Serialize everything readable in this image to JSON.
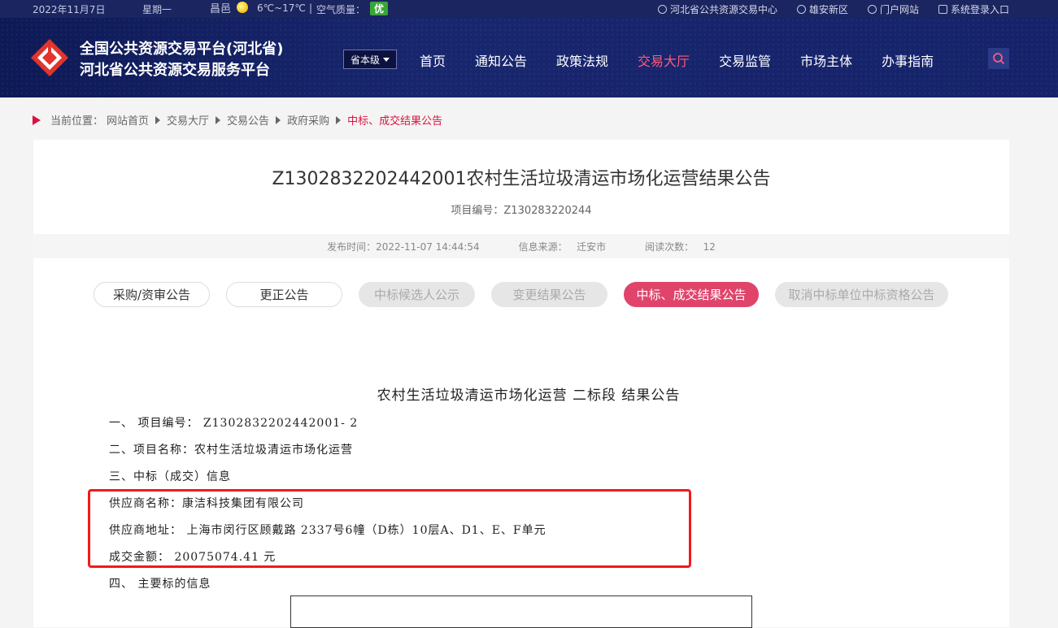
{
  "topbar": {
    "date": "2022年11月7日",
    "weekday": "星期一",
    "city": "昌邑",
    "temp": "6℃~17℃",
    "divider": "|",
    "aq_label": "空气质量：",
    "aq_value": "优",
    "links": [
      {
        "label": "河北省公共资源交易中心",
        "icon": "globe-icon"
      },
      {
        "label": "雄安新区",
        "icon": "globe-icon"
      },
      {
        "label": "门户网站",
        "icon": "globe-icon"
      },
      {
        "label": "系统登录入口",
        "icon": "chart-icon"
      }
    ]
  },
  "header": {
    "line1": "全国公共资源交易平台(河北省)",
    "line2": "河北省公共资源交易服务平台",
    "level": "省本级",
    "nav": [
      "首页",
      "通知公告",
      "政策法规",
      "交易大厅",
      "交易监管",
      "市场主体",
      "办事指南"
    ],
    "active_nav": "交易大厅"
  },
  "breadcrumb": {
    "prefix": "当前位置：",
    "items": [
      "网站首页",
      "交易大厅",
      "交易公告",
      "政府采购"
    ],
    "current": "中标、成交结果公告"
  },
  "notice": {
    "title": "Z1302832202442001农村生活垃圾清运市场化运营结果公告",
    "project_no": "项目编号：Z130283220244",
    "publish_time": "发布时间：2022-11-07 14:44:54",
    "source_label": "信息来源：",
    "source": "迁安市",
    "views_label": "阅读次数：",
    "views": "12"
  },
  "tabs": [
    {
      "label": "采购/资审公告",
      "state": "normal"
    },
    {
      "label": "更正公告",
      "state": "normal"
    },
    {
      "label": "中标候选人公示",
      "state": "disabled"
    },
    {
      "label": "变更结果公告",
      "state": "disabled"
    },
    {
      "label": "中标、成交结果公告",
      "state": "active"
    },
    {
      "label": "取消中标单位中标资格公告",
      "state": "disabled"
    }
  ],
  "doc": {
    "heading": "农村生活垃圾清运市场化运营 二标段 结果公告",
    "l1": "一、 项目编号： Z1302832202442001- 2",
    "l2": "二、项目名称：农村生活垃圾清运市场化运营",
    "l3": "三、中标（成交）信息",
    "l4": "供应商名称：康洁科技集团有限公司",
    "l5": "供应商地址： 上海市闵行区顾戴路 2337号6幢（D栋）10层A、D1、E、F单元",
    "l6": "成交金额： 20075074.41 元",
    "l7": "四、 主要标的信息"
  },
  "colors": {
    "accent": "#e0446b",
    "header_bg": "#16236a",
    "highlight_box": "#f21a1a"
  }
}
